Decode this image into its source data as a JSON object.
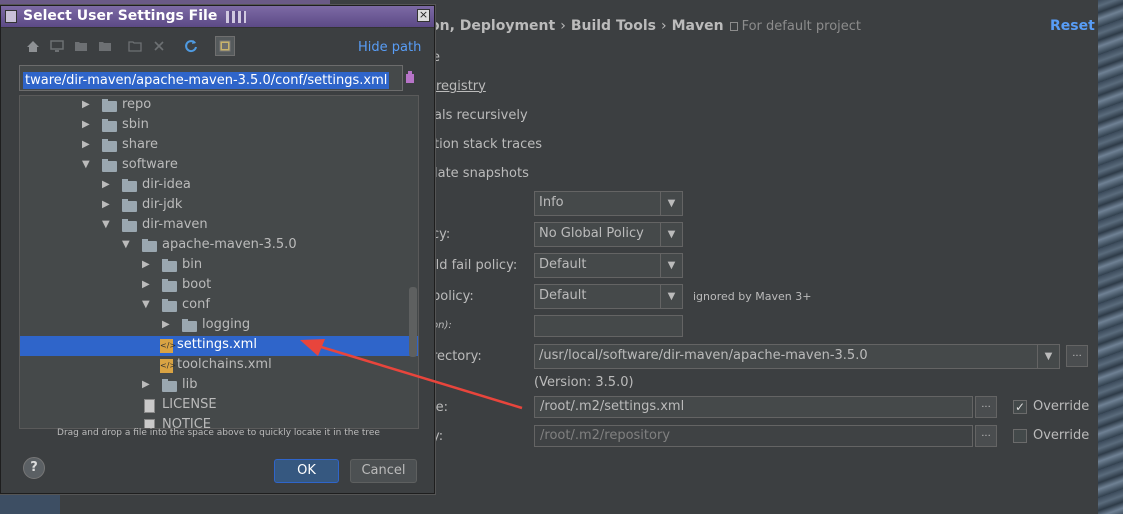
{
  "settings": {
    "breadcrumb": [
      "on, Deployment",
      "Build Tools",
      "Maven"
    ],
    "breadcrumb_sep": "›",
    "project_scope": "For default project",
    "reset_label": "Reset",
    "checkbox_rows": [
      "e",
      "registry",
      "als recursively",
      "tion stack traces",
      "late snapshots"
    ],
    "form": {
      "output_level_label": "",
      "output_level_value": "Info",
      "checksum_label": "cy:",
      "checksum_value": "No Global Policy",
      "multiproject_label": "ild fail policy:",
      "multiproject_value": "Default",
      "plugin_update_label": "policy:",
      "plugin_update_value": "Default",
      "plugin_update_note": "ignored by Maven 3+",
      "threads_label": "on):",
      "threads_value": "",
      "home_label": "rectory:",
      "home_value": "/usr/local/software/dir-maven/apache-maven-3.5.0",
      "version_text": "(Version: 3.5.0)",
      "settings_file_label": "le:",
      "settings_file_value": "/root/.m2/settings.xml",
      "settings_override_label": "Override",
      "settings_override_checked": "✓",
      "repo_label": "y:",
      "repo_value": "/root/.m2/repository",
      "repo_override_label": "Override",
      "dots": "..."
    }
  },
  "dialog": {
    "title": "Select User Settings File",
    "close_glyph": "×",
    "hide_path_label": "Hide path",
    "path_value": "tware/dir-maven/apache-maven-3.5.0/conf/settings.xml",
    "tree": [
      {
        "label": "repo",
        "type": "folder",
        "depth": 0,
        "expanded": false
      },
      {
        "label": "sbin",
        "type": "folder",
        "depth": 0,
        "expanded": false
      },
      {
        "label": "share",
        "type": "folder",
        "depth": 0,
        "expanded": false
      },
      {
        "label": "software",
        "type": "folder",
        "depth": 0,
        "expanded": true
      },
      {
        "label": "dir-idea",
        "type": "folder",
        "depth": 1,
        "expanded": false
      },
      {
        "label": "dir-jdk",
        "type": "folder",
        "depth": 1,
        "expanded": false
      },
      {
        "label": "dir-maven",
        "type": "folder",
        "depth": 1,
        "expanded": true
      },
      {
        "label": "apache-maven-3.5.0",
        "type": "folder",
        "depth": 2,
        "expanded": true
      },
      {
        "label": "bin",
        "type": "folder",
        "depth": 3,
        "expanded": false
      },
      {
        "label": "boot",
        "type": "folder",
        "depth": 3,
        "expanded": false
      },
      {
        "label": "conf",
        "type": "folder",
        "depth": 3,
        "expanded": true
      },
      {
        "label": "logging",
        "type": "folder",
        "depth": 4,
        "expanded": false
      },
      {
        "label": "settings.xml",
        "type": "xml",
        "depth": 4,
        "selected": true
      },
      {
        "label": "toolchains.xml",
        "type": "xml",
        "depth": 4
      },
      {
        "label": "lib",
        "type": "folder",
        "depth": 3,
        "expanded": false
      },
      {
        "label": "LICENSE",
        "type": "file",
        "depth": 3
      },
      {
        "label": "NOTICE",
        "type": "file",
        "depth": 3
      }
    ],
    "hint": "Drag and drop a file into the space above to quickly locate it in the tree",
    "help_label": "?",
    "ok_label": "OK",
    "cancel_label": "Cancel"
  },
  "colors": {
    "selection": "#2f65ca",
    "link": "#589df6",
    "annotation_arrow": "#e8453c"
  }
}
